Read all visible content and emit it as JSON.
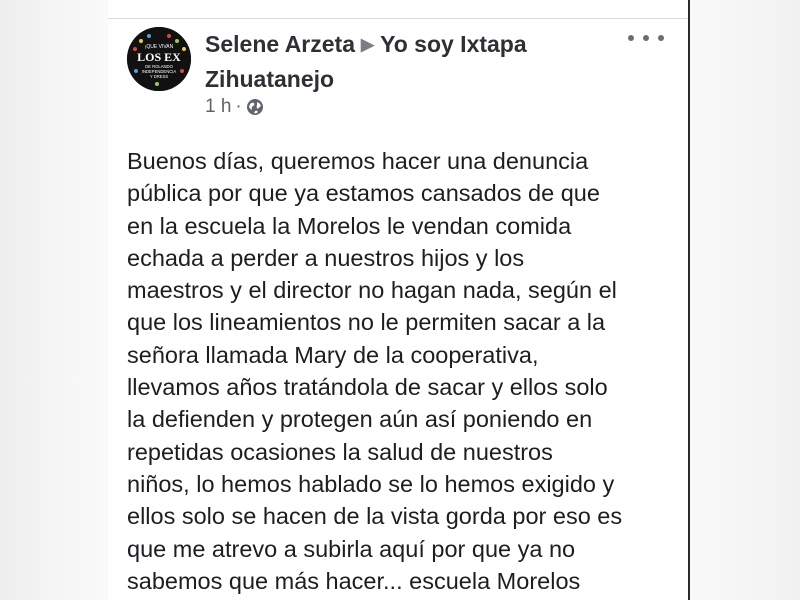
{
  "post": {
    "author": "Selene Arzeta",
    "group_line1": "Yo soy Ixtapa",
    "group_line2": "Zihuatanejo",
    "time": "1 h",
    "avatar_text": {
      "top": "¡QUE VIVAN",
      "main": "LOS EX",
      "sub1": "DE ROLANDO",
      "sub2": "INDEPENDENCIA",
      "sub3": "Y DRESS"
    },
    "body_lines": [
      "Buenos días, queremos hacer una denuncia",
      "pública por que ya estamos cansados de que",
      "en la escuela la Morelos le vendan comida",
      "echada a perder a nuestros hijos y los",
      "maestros y el director no hagan nada, según el",
      "que los lineamientos no le permiten sacar a la",
      "señora llamada Mary de la cooperativa,",
      "llevamos años tratándola de sacar y ellos solo",
      "la defienden y protegen aún así poniendo en",
      "repetidas ocasiones la salud de nuestros",
      "niños, lo hemos hablado se lo hemos exigido y",
      "ellos solo se hacen de la vista gorda por eso es",
      "que me atrevo a subirla aquí por que ya no",
      "sabemos que más hacer... escuela Morelos"
    ]
  },
  "icons": {
    "separator": "triangle-right-icon",
    "privacy": "globe-icon",
    "more": "more-options-icon"
  },
  "colors": {
    "author_text": "#2e3035",
    "body_text": "#1c1e21",
    "meta_text": "#60646c"
  }
}
